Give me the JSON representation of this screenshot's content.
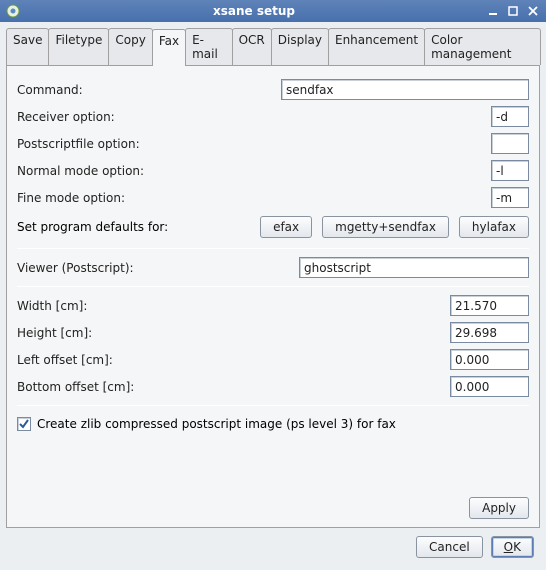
{
  "window": {
    "title": "xsane setup"
  },
  "tabs": [
    "Save",
    "Filetype",
    "Copy",
    "Fax",
    "E-mail",
    "OCR",
    "Display",
    "Enhancement",
    "Color management"
  ],
  "active_tab": 3,
  "fax": {
    "command_label": "Command:",
    "command_value": "sendfax",
    "receiver_label": "Receiver option:",
    "receiver_value": "-d",
    "psfile_label": "Postscriptfile option:",
    "psfile_value": "",
    "normal_label": "Normal mode option:",
    "normal_value": "-l",
    "fine_label": "Fine mode option:",
    "fine_value": "-m",
    "defaults_label": "Set program defaults for:",
    "defaults_buttons": [
      "efax",
      "mgetty+sendfax",
      "hylafax"
    ],
    "viewer_label": "Viewer (Postscript):",
    "viewer_value": "ghostscript",
    "width_label": "Width [cm]:",
    "width_value": "21.570",
    "height_label": "Height [cm]:",
    "height_value": "29.698",
    "left_label": "Left offset [cm]:",
    "left_value": "0.000",
    "bottom_label": "Bottom offset [cm]:",
    "bottom_value": "0.000",
    "zlib_checked": true,
    "zlib_label": "Create zlib compressed postscript image (ps level 3) for fax",
    "apply_label": "Apply"
  },
  "buttons": {
    "cancel": "Cancel",
    "ok_prefix": "O",
    "ok_suffix": "K"
  }
}
